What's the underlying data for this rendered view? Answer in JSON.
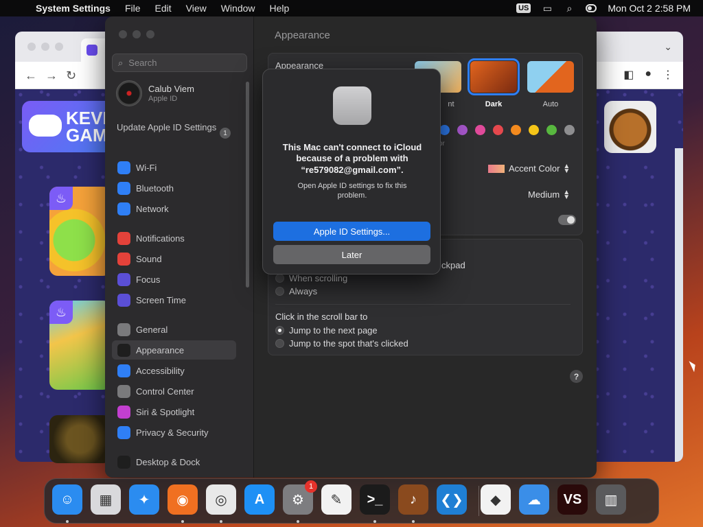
{
  "menubar": {
    "app_name": "System Settings",
    "menus": [
      "File",
      "Edit",
      "View",
      "Window",
      "Help"
    ],
    "input_source": "US",
    "datetime": "Mon Oct 2  2:58 PM"
  },
  "browser": {
    "tab_favicon": "game-controller-icon",
    "logo_text": "KEVI GAME",
    "icons": [
      "back-arrow-icon",
      "forward-arrow-icon",
      "sidebar-icon",
      "profile-icon",
      "more-icon",
      "chevron-down-icon"
    ]
  },
  "sidebar": {
    "search_placeholder": "Search",
    "account": {
      "name": "Calub Viem",
      "subtitle": "Apple ID"
    },
    "update": {
      "label": "Update Apple ID Settings",
      "badge": "1"
    },
    "items": [
      {
        "label": "Wi-Fi",
        "icon": "wifi-icon",
        "color": "#2f7ff6"
      },
      {
        "label": "Bluetooth",
        "icon": "bluetooth-icon",
        "color": "#2f7ff6"
      },
      {
        "label": "Network",
        "icon": "globe-icon",
        "color": "#2f7ff6"
      },
      {
        "label": "Notifications",
        "icon": "bell-icon",
        "color": "#e4423a"
      },
      {
        "label": "Sound",
        "icon": "speaker-icon",
        "color": "#e4423a"
      },
      {
        "label": "Focus",
        "icon": "moon-icon",
        "color": "#5b4fd6"
      },
      {
        "label": "Screen Time",
        "icon": "hourglass-icon",
        "color": "#5b4fd6"
      },
      {
        "label": "General",
        "icon": "gear-icon",
        "color": "#7a7a7c"
      },
      {
        "label": "Appearance",
        "icon": "appearance-icon",
        "color": "#1e1e1e"
      },
      {
        "label": "Accessibility",
        "icon": "accessibility-icon",
        "color": "#2f7ff6"
      },
      {
        "label": "Control Center",
        "icon": "control-center-icon",
        "color": "#7a7a7c"
      },
      {
        "label": "Siri & Spotlight",
        "icon": "siri-icon",
        "color": "#c33fd0"
      },
      {
        "label": "Privacy & Security",
        "icon": "hand-icon",
        "color": "#2f7ff6"
      },
      {
        "label": "Desktop & Dock",
        "icon": "dock-icon",
        "color": "#1e1e1e"
      }
    ],
    "selected": "Appearance"
  },
  "content": {
    "title": "Appearance",
    "appearance_row_label": "Appearance",
    "themes": [
      {
        "label": "Light",
        "caption_visible": "nt",
        "selected": false
      },
      {
        "label": "Dark",
        "caption_visible": "Dark",
        "selected": true
      },
      {
        "label": "Auto",
        "caption_visible": "Auto",
        "selected": false
      }
    ],
    "accent_swatches": [
      "#2f7ff6",
      "#a455c9",
      "#e04a9a",
      "#e5484d",
      "#f38a1e",
      "#f5c518",
      "#58b83f",
      "#8e8e90"
    ],
    "accent_partial_label": "or",
    "accent_color_value": "Accent Color",
    "sidebar_icon_size_value": "Medium",
    "scroll_partial_label": "ckpad",
    "show_scrollbars_options": [
      {
        "label": "When scrolling",
        "selected": false
      },
      {
        "label": "Always",
        "selected": false
      }
    ],
    "click_scrollbar_label": "Click in the scroll bar to",
    "click_scrollbar_options": [
      {
        "label": "Jump to the next page",
        "selected": true
      },
      {
        "label": "Jump to the spot that's clicked",
        "selected": false
      }
    ],
    "help": "?"
  },
  "alert": {
    "title": "This Mac can't connect to iCloud because of a problem with “re579082@gmail.com”.",
    "message": "Open Apple ID settings to fix this problem.",
    "primary_button": "Apple ID Settings...",
    "secondary_button": "Later"
  },
  "dock": {
    "apps": [
      {
        "name": "Finder",
        "icon": "finder-icon",
        "color": "#2b8cf0",
        "glyph": "☺",
        "running": true
      },
      {
        "name": "Launchpad",
        "icon": "launchpad-icon",
        "color": "#d9d9dc",
        "glyph": "▦",
        "running": false
      },
      {
        "name": "Safari",
        "icon": "safari-icon",
        "color": "#2b8cf0",
        "glyph": "✦",
        "running": false
      },
      {
        "name": "Firefox",
        "icon": "firefox-icon",
        "color": "#f07021",
        "glyph": "◉",
        "running": true
      },
      {
        "name": "Chrome",
        "icon": "chrome-icon",
        "color": "#e8e8e8",
        "glyph": "◎",
        "running": true
      },
      {
        "name": "App Store",
        "icon": "app-store-icon",
        "color": "#1e90f5",
        "glyph": "A",
        "running": false
      },
      {
        "name": "System Settings",
        "icon": "system-settings-icon",
        "color": "#7d7d80",
        "glyph": "⚙",
        "running": true,
        "badge": "1"
      },
      {
        "name": "TextEdit",
        "icon": "textedit-icon",
        "color": "#f2f2f2",
        "glyph": "✎",
        "running": false
      },
      {
        "name": "Terminal",
        "icon": "terminal-icon",
        "color": "#1b1b1b",
        "glyph": ">_",
        "running": true
      },
      {
        "name": "GarageBand",
        "icon": "guitar-icon",
        "color": "#8a4a1e",
        "glyph": "♪",
        "running": true
      },
      {
        "name": "Visual Studio Code",
        "icon": "vscode-icon",
        "color": "#1f7fd4",
        "glyph": "❮❯",
        "running": false
      },
      {
        "name": "Visual Studio",
        "icon": "visual-studio-icon",
        "color": "#f2f2f2",
        "glyph": "◆",
        "running": false
      },
      {
        "name": "Weather",
        "icon": "weather-icon",
        "color": "#3a8ee8",
        "glyph": "☁",
        "running": false
      },
      {
        "name": "VS Game",
        "icon": "vs-game-icon",
        "color": "#2a0a0a",
        "glyph": "VS",
        "running": false
      },
      {
        "name": "Trash",
        "icon": "trash-icon",
        "color": "#5a5a5c",
        "glyph": "▥",
        "running": false
      }
    ]
  }
}
